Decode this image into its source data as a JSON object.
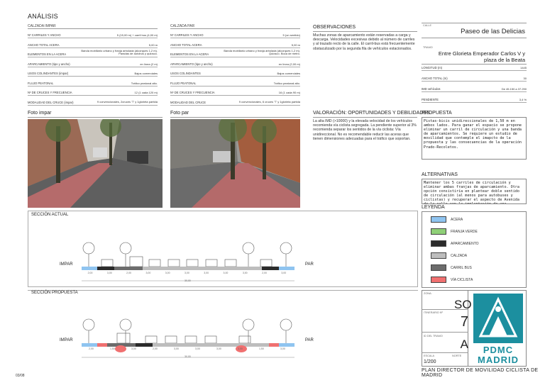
{
  "page_title": "ANÁLISIS",
  "calzada_impar": {
    "heading": "CALZADA IMPAR",
    "rows": [
      {
        "label": "Nº CARRILES Y ANCHO",
        "value": "5 (15,00 m) + carril bus (4,00 m)"
      },
      {
        "label": "ANCHO TOTAL ACERA",
        "value": "5,00 m"
      },
      {
        "label": "ELEMENTOS EN LA ACERA",
        "value": "Banda mobiliario urbano y franja arbolada (alcorques 1,2 m). Paradas de autobus y quiosco."
      },
      {
        "label": "APARCAMIENTO (tipo y ancho)",
        "value": "en línea (2 m)"
      },
      {
        "label": "USOS COLINDANTES (impar)",
        "value": "Bajos comerciales"
      },
      {
        "label": "FLUJO PEATONAL",
        "value": "Tráfico peatonal alto."
      },
      {
        "label": "Nº DE CRUCES Y FRECUENCIA",
        "value": "12 (1 cada 120 m)"
      },
      {
        "label": "MODALIDAD DEL CRUCE (impar)",
        "value": "9 convencionales, 2cruces 'T' y 1glorieta partida"
      }
    ]
  },
  "calzada_par": {
    "heading": "CALZADA PAR",
    "rows": [
      {
        "label": "Nº CARRILES Y ANCHO",
        "value": "5 (un sentido)"
      },
      {
        "label": "ANCHO TOTAL ACERA",
        "value": "5,00 m"
      },
      {
        "label": "ELEMENTOS EN LA ACERA",
        "value": "Banda mobiliario urbano y franja arbolada (alcorques 1,2 m). Quiosco. Boca de metro."
      },
      {
        "label": "APARCAMIENTO (tipo y ancho)",
        "value": "en línea (2,00 m)"
      },
      {
        "label": "USOS COLINDANTES",
        "value": "Bajos comerciales"
      },
      {
        "label": "FLUJO PEATONAL",
        "value": "Tráfico peatonal alto."
      },
      {
        "label": "Nº DE CRUCES Y FRECUENCIA",
        "value": "16 (1 cada 90 m)"
      },
      {
        "label": "MODALIDAD DEL CRUCE",
        "value": "9 convencionales, 6 cruces 'T' y 1glorieta partida"
      }
    ]
  },
  "observaciones": {
    "heading": "OBSERVACIONES",
    "text": "Muchas zonas de aparcamiento están reservadas a carga y descarga. Velocidades excesivas debido al número de carriles y al trazado recto de la calle. El carril-bus está frecuentemente obstaculizado por la segunda fila de vehículos estacionados."
  },
  "calle": {
    "tag": "CALLE",
    "name": "Paseo de las Delicias"
  },
  "tramo": {
    "tag": "TRAMO",
    "name": "Entre Glorieta Emperador Carlos V y plaza de la Beata"
  },
  "facts": [
    {
      "label": "LONGITUD (m)",
      "value": "1445"
    },
    {
      "label": "ANCHO TOTAL (m)",
      "value": "30"
    },
    {
      "label": "IMD vehículos",
      "value": "De 45.150 a 37.290"
    },
    {
      "label": "PENDIENTE",
      "value": "3,4 %"
    }
  ],
  "foto_impar": "Foto impar",
  "foto_par": "Foto par",
  "valoracion": {
    "heading": "VALORACIÓN: OPORTUNIDADES Y DEBILIDADES",
    "text": "La alta IMD (>10000) y la elevada velocidad de los vehículos recomienda vía ciclista segregada. La pendiente superior al 3% recomienda separar los sentidos de la vía ciclista: Vía unidireccional. No es recomendable reducir las aceras que tienen dimensiones adecuadas para el tráfico que soportan."
  },
  "propuesta": {
    "heading": "PROPUESTA",
    "text": "Pistas-bicis unidireccionales de 1,50 m en ambos lados. Para ganar el espacio se propone eliminar un carril de circulación y una banda de aparcamientos. Se requiere un estudio de movilidad que contemple el imapcto de la propuesta y las consecuencias de la operación Prado-Recoletos."
  },
  "alternativas": {
    "heading": "ALTERNATIVAS",
    "text": "Mantener los 5 carriles de circulación y eliminar ambas franjas de aparcamiento. Otra opción consistiría en plantear doble sentido de circulación (al menos para autobuses y ciclistas) y recuperar el aspecto de Avenida de la calle con la implantación de una mediana."
  },
  "leyenda": {
    "heading": "LEYENDA",
    "items": [
      {
        "label": "ACERA",
        "color": "#8fc4f0"
      },
      {
        "label": "FRANJA VERDE",
        "color": "#8fd078"
      },
      {
        "label": "APARCAMIENTO",
        "color": "#2b2b2b"
      },
      {
        "label": "CALZADA",
        "color": "#bdbdbd"
      },
      {
        "label": "CARRIL BUS",
        "color": "#6c6c6c"
      },
      {
        "label": "VÍA CICLISTA",
        "color": "#f07070"
      }
    ]
  },
  "seccion_actual": {
    "heading": "SECCIÓN ACTUAL",
    "left": "IMPAR",
    "right": "PAR",
    "dims": [
      "2,00",
      "3,00",
      "2,00",
      "3,00",
      "3,00",
      "3,00",
      "3,00",
      "3,00",
      "3,00",
      "2,00",
      "3,00"
    ],
    "total": "30,00"
  },
  "seccion_propuesta": {
    "heading": "SECCIÓN PROPUESTA",
    "left": "IMPAR",
    "right": "PAR",
    "dims": [
      "2,00",
      "1,50",
      "3,00",
      "2,00",
      "3,00",
      "3,00",
      "3,00",
      "3,00",
      "1,50",
      "3,00"
    ],
    "total": "30,00"
  },
  "zona": {
    "tag": "ZONA:",
    "value": "SO"
  },
  "itinerario": {
    "tag": "ITINERARIO Nº",
    "value": "7"
  },
  "id_tramo": {
    "tag": "ID DEL TRAMO",
    "value": "A"
  },
  "escala": {
    "tag": "ESCALA",
    "value": "1/200"
  },
  "norte": {
    "tag": "NORTE"
  },
  "logo": {
    "top": "PDMC",
    "bottom": "MADRID"
  },
  "footer_title": "PLAN DIRECTOR DE MOVILIDAD CICLISTA DE MADRID",
  "page_number": "03/08",
  "colors": {
    "accent": "#1c8f9f",
    "bike_lane": "#f07070",
    "sidewalk": "#8fc4f0"
  }
}
